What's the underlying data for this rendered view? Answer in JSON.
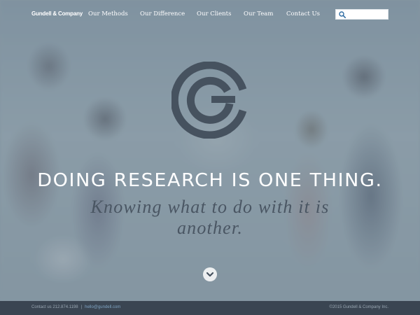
{
  "brand": {
    "name": "Gundell & Company"
  },
  "nav": {
    "items": [
      {
        "label": "Our Methods"
      },
      {
        "label": "Our Difference"
      },
      {
        "label": "Our Clients"
      },
      {
        "label": "Our Team"
      },
      {
        "label": "Contact Us"
      }
    ]
  },
  "search": {
    "placeholder": "",
    "value": ""
  },
  "hero": {
    "headline": "DOING RESEARCH IS ONE THING.",
    "subhead": "Knowing what to do with it is another."
  },
  "footer": {
    "contact_prefix": "Contact us 212.874.1198",
    "separator": "|",
    "email": "hello@gundell.com",
    "copyright": "©2015 Gundell & Company Inc."
  },
  "colors": {
    "logo": "#46525f",
    "headline": "#ffffff",
    "subhead": "#4a5663",
    "footer_bg": "#3a4552",
    "link": "#7fa3c2"
  },
  "icons": {
    "logo": "gc-monogram-logo",
    "search": "search-icon",
    "scroll": "chevron-down-icon"
  }
}
